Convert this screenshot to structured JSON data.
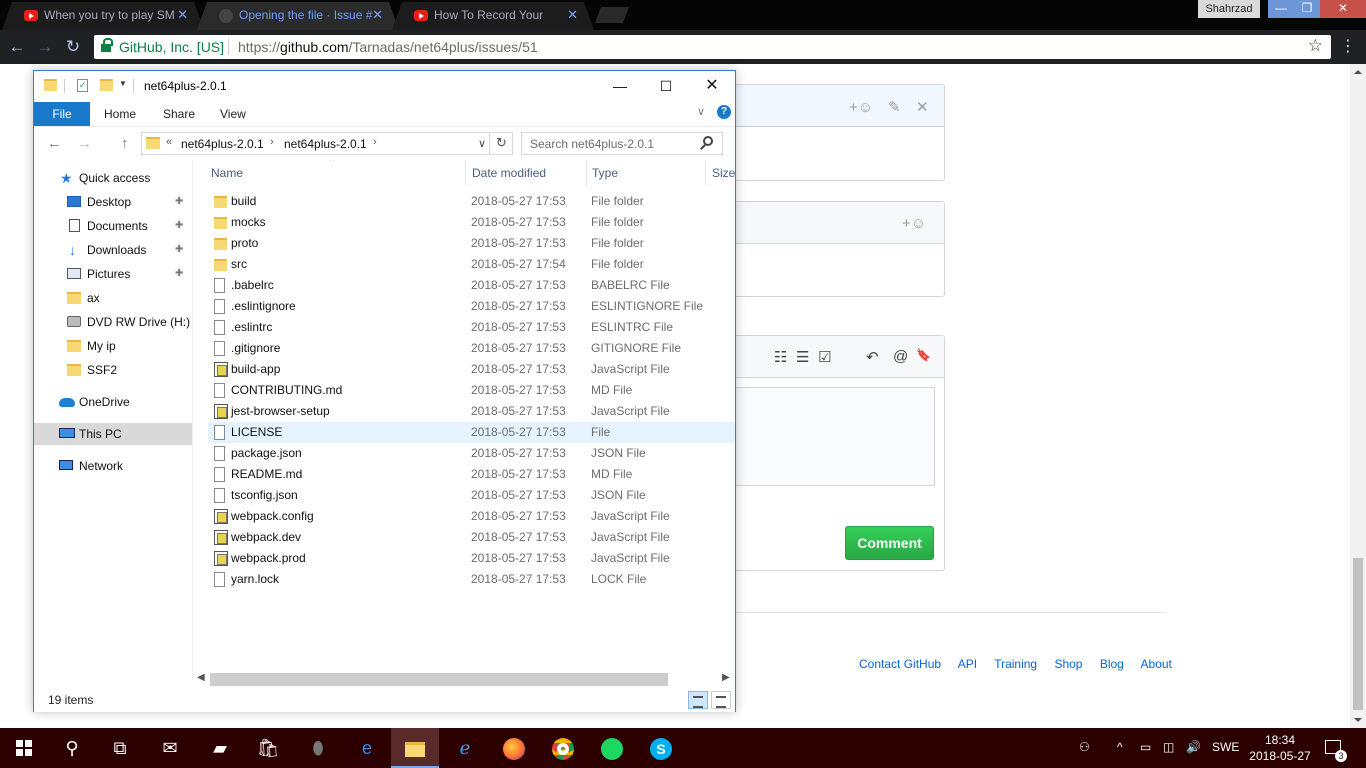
{
  "chrome": {
    "tabs": [
      {
        "title": "When you try to play SM",
        "close": "✕"
      },
      {
        "title": "Opening the file · Issue #",
        "close": "✕"
      },
      {
        "title": "How To Record Your",
        "close": "✕"
      }
    ],
    "profile": "Shahrzad",
    "window_controls": {
      "minimize": "—",
      "maximize": "❐",
      "close": "✕"
    },
    "nav": {
      "back": "←",
      "forward": "→",
      "reload": "↻"
    },
    "secure_label": "GitHub, Inc. [US]",
    "url_scheme": "https://",
    "url_host": "github.com",
    "url_path": "/Tarnadas/net64plus/issues/51",
    "star": "☆",
    "menu": "⋮"
  },
  "github": {
    "emoji_icon_1": "+☺",
    "edit_icon": "✎",
    "close_icon": "✕",
    "emoji_icon_2": "+☺",
    "toolbar_icons": [
      "☷",
      "☰",
      "☑",
      "↶",
      "@",
      "🔖"
    ],
    "comment_button": "Comment",
    "footer_links": [
      "Contact GitHub",
      "API",
      "Training",
      "Shop",
      "Blog",
      "About"
    ]
  },
  "explorer": {
    "title": "net64plus-2.0.1",
    "window_controls": {
      "minimize": "—",
      "maximize": "☐",
      "close": "✕"
    },
    "ribbon_tabs": [
      "File",
      "Home",
      "Share",
      "View"
    ],
    "help": "?",
    "breadcrumb": [
      "net64plus-2.0.1",
      "net64plus-2.0.1"
    ],
    "breadcrumb_prefix": "«",
    "search_placeholder": "Search net64plus-2.0.1",
    "nav": {
      "back": "←",
      "forward": "→",
      "up": "↑",
      "refresh": "↻"
    },
    "nav_pane": [
      {
        "label": "Quick access",
        "icon": "star-icon",
        "pinned": false
      },
      {
        "label": "Desktop",
        "icon": "desktop-icon",
        "pinned": true
      },
      {
        "label": "Documents",
        "icon": "documents-icon",
        "pinned": true
      },
      {
        "label": "Downloads",
        "icon": "downloads-icon",
        "pinned": true
      },
      {
        "label": "Pictures",
        "icon": "pictures-icon",
        "pinned": true
      },
      {
        "label": "ax",
        "icon": "folder-icon",
        "pinned": false
      },
      {
        "label": "DVD RW Drive (H:)",
        "icon": "dvd-icon",
        "pinned": false
      },
      {
        "label": "My ip",
        "icon": "folder-icon",
        "pinned": false
      },
      {
        "label": "SSF2",
        "icon": "folder-icon",
        "pinned": false
      },
      {
        "label": "OneDrive",
        "icon": "onedrive-icon",
        "pinned": false
      },
      {
        "label": "This PC",
        "icon": "pc-icon",
        "pinned": false,
        "selected": true
      },
      {
        "label": "Network",
        "icon": "network-icon",
        "pinned": false
      }
    ],
    "pin_glyph": "📌",
    "columns": {
      "name": "Name",
      "date": "Date modified",
      "type": "Type",
      "size": "Size"
    },
    "files": [
      {
        "name": "build",
        "date": "2018-05-27 17:53",
        "type": "File folder",
        "icon": "folder"
      },
      {
        "name": "mocks",
        "date": "2018-05-27 17:53",
        "type": "File folder",
        "icon": "folder"
      },
      {
        "name": "proto",
        "date": "2018-05-27 17:53",
        "type": "File folder",
        "icon": "folder"
      },
      {
        "name": "src",
        "date": "2018-05-27 17:54",
        "type": "File folder",
        "icon": "folder"
      },
      {
        "name": ".babelrc",
        "date": "2018-05-27 17:53",
        "type": "BABELRC File",
        "icon": "doc"
      },
      {
        "name": ".eslintignore",
        "date": "2018-05-27 17:53",
        "type": "ESLINTIGNORE File",
        "icon": "doc"
      },
      {
        "name": ".eslintrc",
        "date": "2018-05-27 17:53",
        "type": "ESLINTRC File",
        "icon": "doc"
      },
      {
        "name": ".gitignore",
        "date": "2018-05-27 17:53",
        "type": "GITIGNORE File",
        "icon": "doc"
      },
      {
        "name": "build-app",
        "date": "2018-05-27 17:53",
        "type": "JavaScript File",
        "icon": "js"
      },
      {
        "name": "CONTRIBUTING.md",
        "date": "2018-05-27 17:53",
        "type": "MD File",
        "icon": "doc"
      },
      {
        "name": "jest-browser-setup",
        "date": "2018-05-27 17:53",
        "type": "JavaScript File",
        "icon": "js"
      },
      {
        "name": "LICENSE",
        "date": "2018-05-27 17:53",
        "type": "File",
        "icon": "doc",
        "highlight": true
      },
      {
        "name": "package.json",
        "date": "2018-05-27 17:53",
        "type": "JSON File",
        "icon": "doc"
      },
      {
        "name": "README.md",
        "date": "2018-05-27 17:53",
        "type": "MD File",
        "icon": "doc"
      },
      {
        "name": "tsconfig.json",
        "date": "2018-05-27 17:53",
        "type": "JSON File",
        "icon": "doc"
      },
      {
        "name": "webpack.config",
        "date": "2018-05-27 17:53",
        "type": "JavaScript File",
        "icon": "js"
      },
      {
        "name": "webpack.dev",
        "date": "2018-05-27 17:53",
        "type": "JavaScript File",
        "icon": "js"
      },
      {
        "name": "webpack.prod",
        "date": "2018-05-27 17:53",
        "type": "JavaScript File",
        "icon": "js"
      },
      {
        "name": "yarn.lock",
        "date": "2018-05-27 17:53",
        "type": "LOCK File",
        "icon": "doc"
      }
    ],
    "status_count": "19 items"
  },
  "taskbar": {
    "apps": [
      "search",
      "task-view",
      "mail",
      "sticky-notes",
      "store",
      "mouse",
      "edge",
      "file-explorer",
      "internet-explorer",
      "firefox",
      "chrome",
      "spotify",
      "skype"
    ],
    "active_app": "file-explorer",
    "tray_icons": {
      "people": "⚇",
      "chevron": "^",
      "battery": "▭",
      "network": "◫",
      "volume": "🔊"
    },
    "language": "SWE",
    "time": "18:34",
    "date": "2018-05-27",
    "notification_count": "3"
  }
}
